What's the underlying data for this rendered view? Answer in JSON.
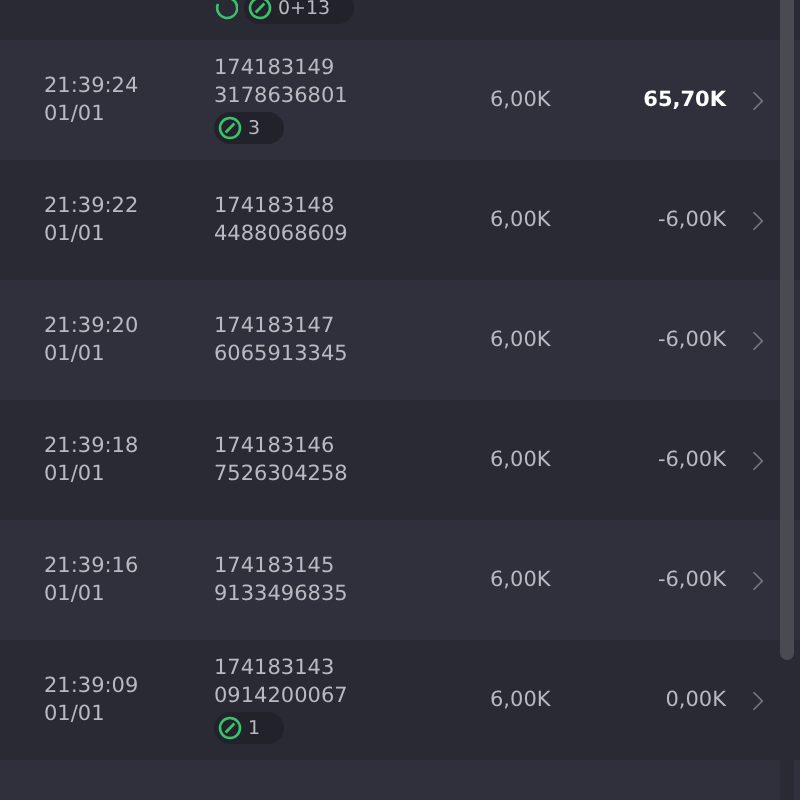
{
  "partial_top": {
    "pending": true,
    "badge": {
      "count": "0+13"
    }
  },
  "rows": [
    {
      "time": "21:39:24",
      "date": "01/01",
      "id": "174183149",
      "ref": "3178636801",
      "badge": {
        "count": "3"
      },
      "stake": "6,00K",
      "result": "65,70K",
      "emphasized": true
    },
    {
      "time": "21:39:22",
      "date": "01/01",
      "id": "174183148",
      "ref": "4488068609",
      "stake": "6,00K",
      "result": "-6,00K",
      "emphasized": false
    },
    {
      "time": "21:39:20",
      "date": "01/01",
      "id": "174183147",
      "ref": "6065913345",
      "stake": "6,00K",
      "result": "-6,00K",
      "emphasized": false
    },
    {
      "time": "21:39:18",
      "date": "01/01",
      "id": "174183146",
      "ref": "7526304258",
      "stake": "6,00K",
      "result": "-6,00K",
      "emphasized": false
    },
    {
      "time": "21:39:16",
      "date": "01/01",
      "id": "174183145",
      "ref": "9133496835",
      "stake": "6,00K",
      "result": "-6,00K",
      "emphasized": false
    },
    {
      "time": "21:39:09",
      "date": "01/01",
      "id": "174183143",
      "ref": "0914200067",
      "badge": {
        "count": "1"
      },
      "stake": "6,00K",
      "result": "0,00K",
      "emphasized": false
    }
  ]
}
